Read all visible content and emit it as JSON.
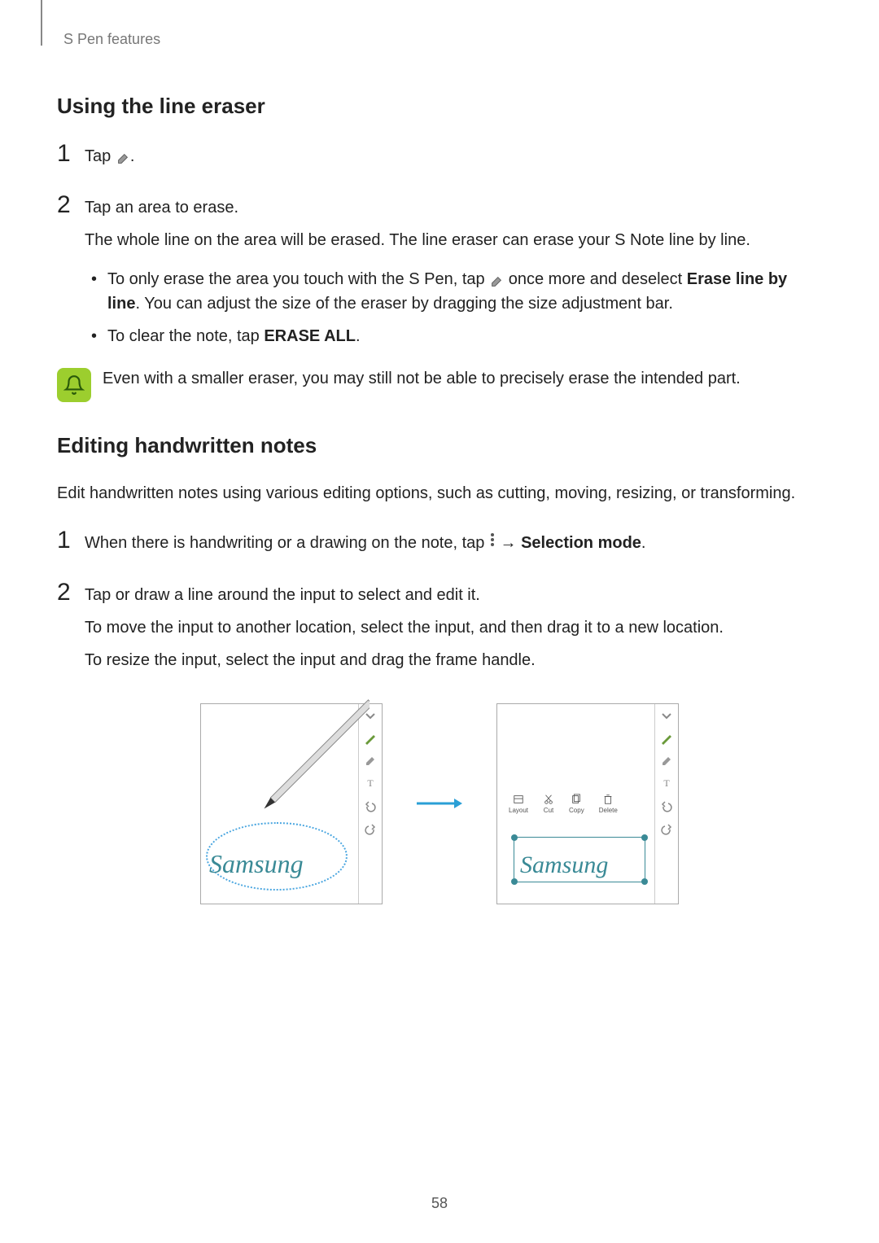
{
  "header": "S Pen features",
  "section1": {
    "title": "Using the line eraser",
    "step1": {
      "num": "1",
      "prefix": "Tap ",
      "suffix": "."
    },
    "step2": {
      "num": "2",
      "line1": "Tap an area to erase.",
      "line2": "The whole line on the area will be erased. The line eraser can erase your S Note line by line.",
      "bullet1_pre": "To only erase the area you touch with the S Pen, tap ",
      "bullet1_post": " once more and deselect ",
      "bullet1_bold": "Erase line by line",
      "bullet1_end": ". You can adjust the size of the eraser by dragging the size adjustment bar.",
      "bullet2_pre": "To clear the note, tap ",
      "bullet2_bold": "ERASE ALL",
      "bullet2_end": "."
    },
    "note": "Even with a smaller eraser, you may still not be able to precisely erase the intended part."
  },
  "section2": {
    "title": "Editing handwritten notes",
    "intro": "Edit handwritten notes using various editing options, such as cutting, moving, resizing, or transforming.",
    "step1": {
      "num": "1",
      "pre": "When there is handwriting or a drawing on the note, tap ",
      "arrow": " → ",
      "bold": "Selection mode",
      "end": "."
    },
    "step2": {
      "num": "2",
      "line1": "Tap or draw a line around the input to select and edit it.",
      "line2": "To move the input to another location, select the input, and then drag it to a new location.",
      "line3": "To resize the input, select the input and drag the frame handle."
    }
  },
  "illustration": {
    "handwriting_left": "Samsung",
    "handwriting_right": "Samsung",
    "ctx": {
      "layout": "Layout",
      "cut": "Cut",
      "copy": "Copy",
      "delete": "Delete"
    }
  },
  "page_number": "58"
}
